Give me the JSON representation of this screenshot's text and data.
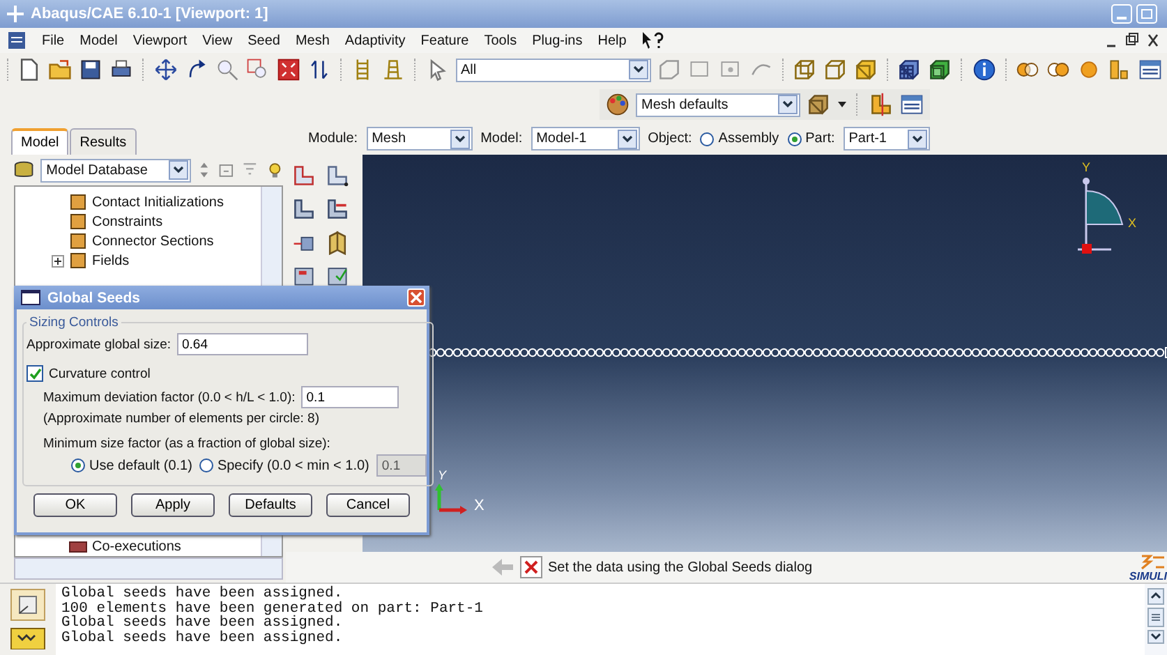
{
  "window": {
    "title": "Abaqus/CAE 6.10-1 [Viewport: 1]"
  },
  "menu": [
    "File",
    "Model",
    "Viewport",
    "View",
    "Seed",
    "Mesh",
    "Adaptivity",
    "Feature",
    "Tools",
    "Plug-ins",
    "Help"
  ],
  "toolbar": {
    "selection_filter": "All",
    "mesh_defaults": "Mesh defaults"
  },
  "tabs": [
    {
      "label": "Model",
      "selected": true
    },
    {
      "label": "Results",
      "selected": false
    }
  ],
  "context": {
    "module_label": "Module:",
    "module": "Mesh",
    "model_label": "Model:",
    "model": "Model-1",
    "object_label": "Object:",
    "objects": [
      {
        "label": "Assembly",
        "selected": false
      },
      {
        "label": "Part:",
        "selected": true
      }
    ],
    "part": "Part-1"
  },
  "tree": {
    "source": "Model Database",
    "items": [
      {
        "label": "Contact Initializations",
        "kind": "leaf"
      },
      {
        "label": "Constraints",
        "kind": "leaf"
      },
      {
        "label": "Connector Sections",
        "kind": "leaf"
      },
      {
        "label": "Fields",
        "kind": "collapsed"
      }
    ],
    "bottom_item": "Co-executions"
  },
  "viewport": {
    "compass": {
      "y": "Y",
      "x": "X"
    },
    "triad": {
      "y": "Y",
      "x": "X"
    }
  },
  "prompt": "Set the data using the Global Seeds dialog",
  "brand": "SIMULI",
  "messages": [
    "Global seeds have been assigned.",
    "100 elements have been generated on part: Part-1",
    "Global seeds have been assigned.",
    "Global seeds have been assigned."
  ],
  "dialog": {
    "title": "Global Seeds",
    "group": "Sizing Controls",
    "global_size_label": "Approximate global size:",
    "global_size": "0.64",
    "curvature": {
      "label": "Curvature control",
      "checked": true
    },
    "deviation_label": "Maximum deviation factor (0.0 < h/L < 1.0):",
    "deviation": "0.1",
    "elements_note": "(Approximate number of elements per circle: 8)",
    "min_size_label": "Minimum size factor (as a fraction of global size):",
    "min_options": [
      {
        "label": "Use default (0.1)",
        "selected": true
      },
      {
        "label": "Specify (0.0 < min < 1.0)",
        "selected": false
      }
    ],
    "min_value": "0.1",
    "min_value_disabled": true,
    "buttons": [
      "OK",
      "Apply",
      "Defaults",
      "Cancel"
    ]
  }
}
